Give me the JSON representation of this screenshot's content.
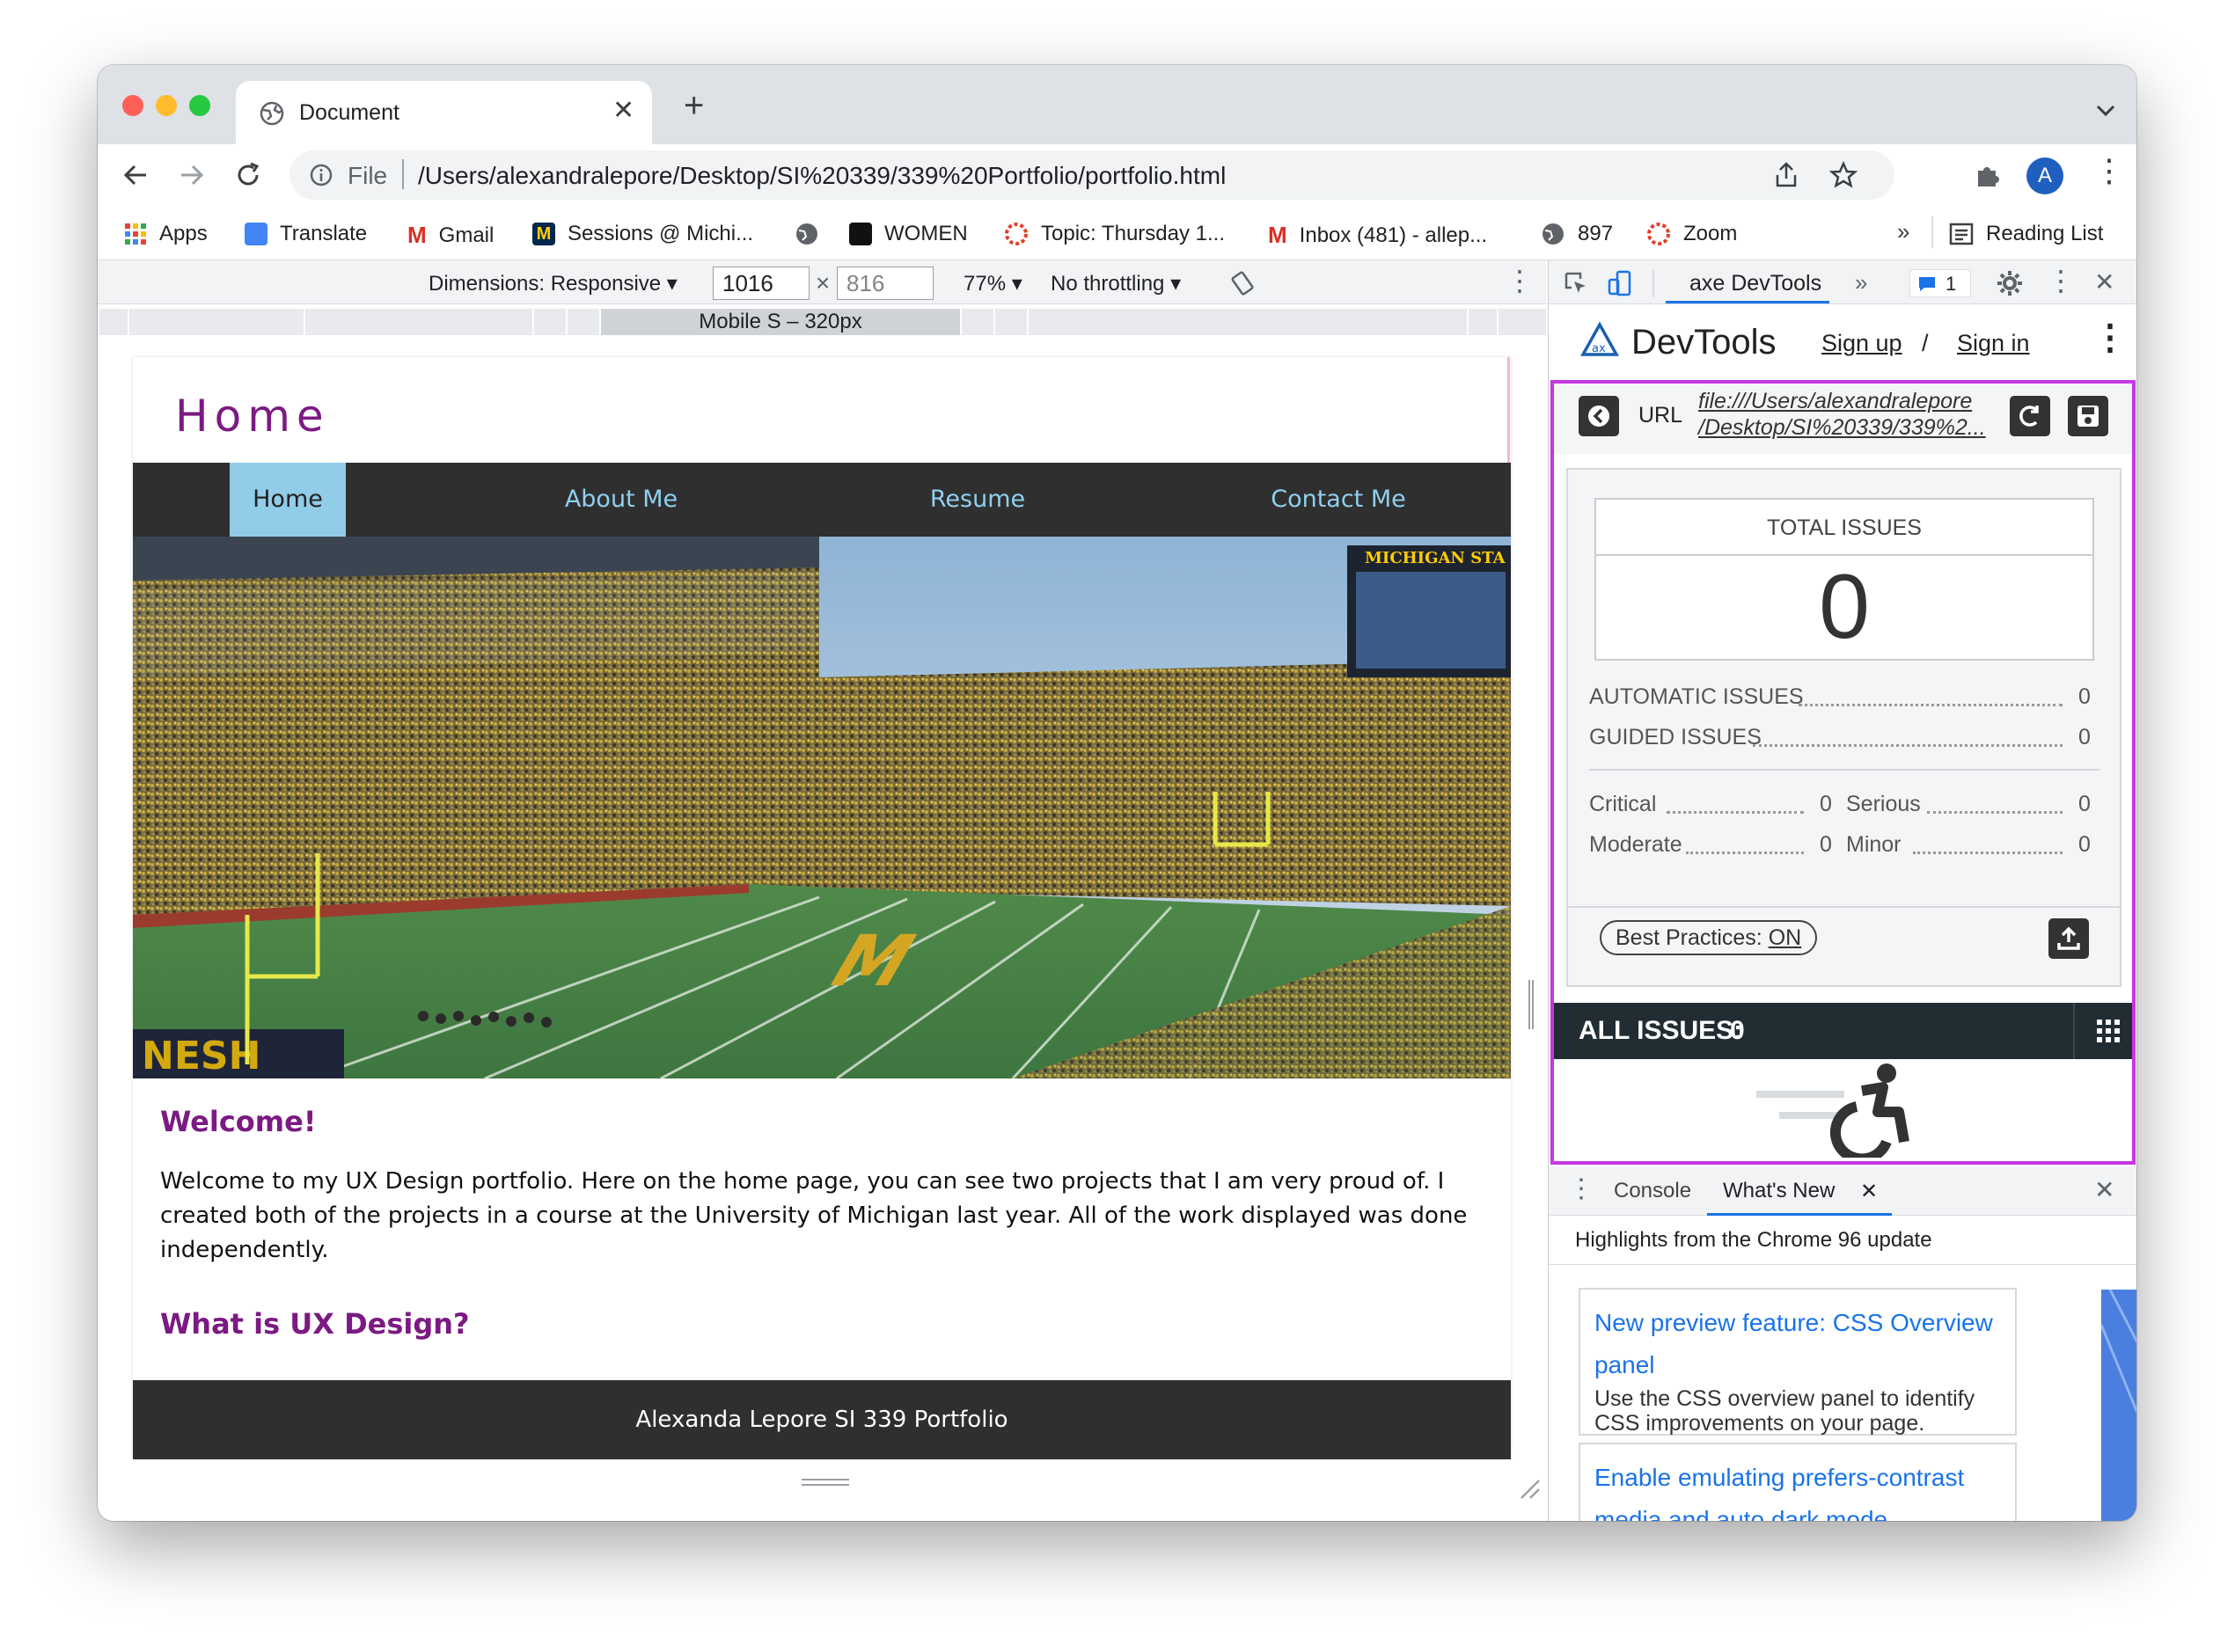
{
  "browser": {
    "tab_title": "Document",
    "address_prefix": "File",
    "url": "/Users/alexandralepore/Desktop/SI%20339/339%20Portfolio/portfolio.html",
    "avatar_letter": "A",
    "bookmarks": [
      {
        "label": "Apps"
      },
      {
        "label": "Translate"
      },
      {
        "label": "Gmail"
      },
      {
        "label": "Sessions @ Michi..."
      },
      {
        "label": ""
      },
      {
        "label": "WOMEN"
      },
      {
        "label": "Topic: Thursday 1..."
      },
      {
        "label": "Inbox (481) - allep..."
      },
      {
        "label": "897"
      },
      {
        "label": "Zoom"
      }
    ],
    "overflow_chevron": "»",
    "reading_list": "Reading List"
  },
  "device_toolbar": {
    "dimensions_label": "Dimensions: Responsive ▾",
    "width": "1016",
    "height_placeholder": "816",
    "times": "×",
    "zoom": "77% ▾",
    "throttling": "No throttling ▾",
    "media_label": "Mobile S – 320px"
  },
  "page": {
    "header_title": "Home",
    "nav": [
      "Home",
      "About Me",
      "Resume",
      "Contact Me"
    ],
    "scoreboard_text": "MICHIGAN STA",
    "welcome_heading": "Welcome!",
    "welcome_text": "Welcome to my UX Design portfolio. Here on the home page, you can see two projects that I am very proud of. I created both of the projects in a course at the University of Michigan last year. All of the work displayed was done independently.",
    "what_heading": "What is UX Design?",
    "footer": "Alexanda Lepore SI 339 Portfolio"
  },
  "devtools": {
    "active_tab": "axe DevTools",
    "more_tabs": "»",
    "issues_badge": "1",
    "axe": {
      "brand": "DevTools",
      "sign_up": "Sign up",
      "separator": "/",
      "sign_in": "Sign in",
      "url_label": "URL",
      "url_line1": "file:///Users/alexandralepore",
      "url_line2": "/Desktop/SI%20339/339%2...",
      "total_issues_label": "TOTAL ISSUES",
      "total_issues": "0",
      "automatic_label": "AUTOMATIC ISSUES",
      "automatic": "0",
      "guided_label": "GUIDED ISSUES",
      "guided": "0",
      "critical_label": "Critical",
      "critical": "0",
      "serious_label": "Serious",
      "serious": "0",
      "moderate_label": "Moderate",
      "moderate": "0",
      "minor_label": "Minor",
      "minor": "0",
      "best_practices_label": "Best Practices:",
      "best_practices_value": "ON",
      "all_issues_label": "ALL ISSUES:",
      "all_issues_count": "0"
    },
    "drawer": {
      "tabs": [
        "Console",
        "What's New"
      ],
      "highlight": "Highlights from the Chrome 96 update",
      "cards": [
        {
          "title": "New preview feature: CSS Overview panel",
          "desc": "Use the CSS overview panel to identify CSS improvements on your page."
        },
        {
          "title": "Enable emulating prefers-contrast media and auto dark mode",
          "desc": ""
        }
      ]
    }
  },
  "colors": {
    "accent_purple": "#7b1a83",
    "nav_bg": "#2f2f2f",
    "nav_link": "#8fd0ef",
    "nav_active_bg": "#91cce9",
    "axe_highlight": "#c637e0",
    "link_blue": "#1a73e8"
  }
}
